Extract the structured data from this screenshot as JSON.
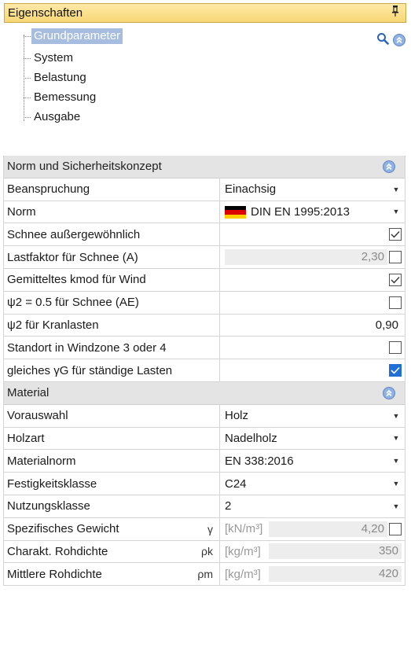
{
  "panel": {
    "title": "Eigenschaften"
  },
  "tree": {
    "items": [
      {
        "label": "Grundparameter",
        "selected": true
      },
      {
        "label": "System",
        "selected": false
      },
      {
        "label": "Belastung",
        "selected": false
      },
      {
        "label": "Bemessung",
        "selected": false
      },
      {
        "label": "Ausgabe",
        "selected": false
      }
    ]
  },
  "sections": {
    "norm": {
      "title": "Norm und Sicherheitskonzept",
      "rows": [
        {
          "name": "Beanspruchung",
          "value": "Einachsig",
          "type": "dropdown"
        },
        {
          "name": "Norm",
          "value": "DIN EN 1995:2013",
          "type": "dropdown",
          "flag": "germany"
        },
        {
          "name": "Schnee außergewöhnlich",
          "type": "checkbox",
          "checked": true
        },
        {
          "name": "Lastfaktor für Schnee (A)",
          "value": "2,30",
          "type": "greyed-checkbox",
          "checked": false
        },
        {
          "name": "Gemitteltes kmod für Wind",
          "type": "checkbox",
          "checked": true
        },
        {
          "name": "ψ2 = 0.5 für Schnee (AE)",
          "type": "checkbox",
          "checked": false
        },
        {
          "name": "ψ2 für Kranlasten",
          "value": "0,90",
          "type": "number"
        },
        {
          "name": "Standort in Windzone 3 oder 4",
          "type": "checkbox",
          "checked": false
        },
        {
          "name": "gleiches γG für ständige Lasten",
          "type": "checkbox",
          "checked": true,
          "focused": true
        }
      ]
    },
    "material": {
      "title": "Material",
      "rows": [
        {
          "name": "Vorauswahl",
          "value": "Holz",
          "type": "dropdown"
        },
        {
          "name": "Holzart",
          "value": "Nadelholz",
          "type": "dropdown"
        },
        {
          "name": "Materialnorm",
          "value": "EN 338:2016",
          "type": "dropdown"
        },
        {
          "name": "Festigkeitsklasse",
          "value": "C24",
          "type": "dropdown"
        },
        {
          "name": "Nutzungsklasse",
          "value": "2",
          "type": "dropdown"
        },
        {
          "name": "Spezifisches Gewicht",
          "symbol": "γ",
          "unit": "[kN/m³]",
          "value": "4,20",
          "type": "unit-greyed-checkbox",
          "checked": false
        },
        {
          "name": "Charakt. Rohdichte",
          "symbol": "ρk",
          "unit": "[kg/m³]",
          "value": "350",
          "type": "unit-readonly"
        },
        {
          "name": "Mittlere Rohdichte",
          "symbol": "ρm",
          "unit": "[kg/m³]",
          "value": "420",
          "type": "unit-readonly"
        }
      ]
    }
  },
  "colors": {
    "title_bar": "#f8d774",
    "selection": "#a7bde0",
    "section_bg": "#e4e4e4",
    "checkbox_focus": "#1f6fd6"
  },
  "icons": [
    "pin-icon",
    "search-icon",
    "collapse-icon",
    "chevron-down-icon",
    "germany-flag-icon",
    "check-icon"
  ]
}
